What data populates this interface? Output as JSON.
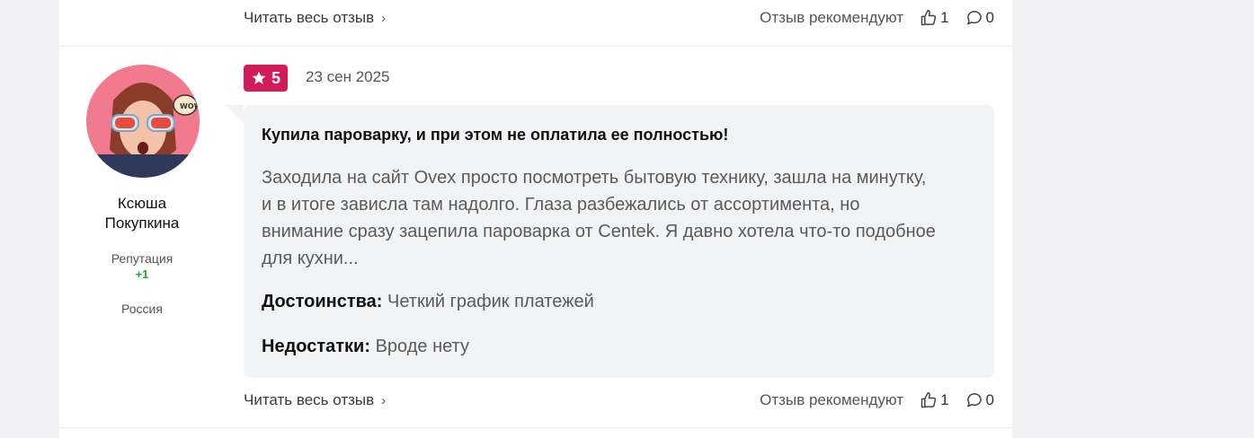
{
  "top_actions": {
    "read_more": "Читать весь отзыв",
    "recommend_label": "Отзыв рекомендуют",
    "likes": "1",
    "comments": "0"
  },
  "review": {
    "author": {
      "name_line1": "Ксюша",
      "name_line2": "Покупкина",
      "reputation_label": "Репутация",
      "reputation_value": "+1",
      "country": "Россия"
    },
    "rating": "5",
    "date": "23 сен 2025",
    "title": "Купила пароварку, и при этом не оплатила ее полностью!",
    "body_lines": [
      "Заходила на сайт Ovex просто посмотреть бытовую технику, зашла на минутку,",
      "и в итоге зависла там надолго. Глаза разбежались от ассортимента, но",
      "внимание сразу зацепила пароварка от Centek. Я давно хотела что-то подобное",
      "для кухни..."
    ],
    "pros_label": "Достоинства:",
    "pros_text": "Четкий график платежей",
    "cons_label": "Недостатки:",
    "cons_text": "Вроде нету",
    "actions": {
      "read_more": "Читать весь отзыв",
      "recommend_label": "Отзыв рекомендуют",
      "likes": "1",
      "comments": "0"
    }
  },
  "colors": {
    "rating_badge": "#d11b5a",
    "reputation_positive": "#1fa83b",
    "bubble_bg": "#f2f3f5"
  }
}
